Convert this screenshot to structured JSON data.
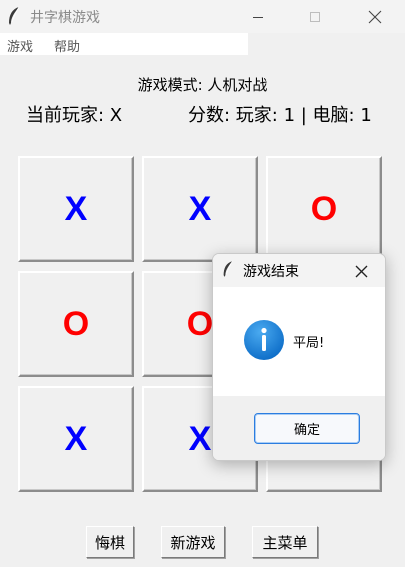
{
  "window": {
    "title": "井字棋游戏",
    "icon": "feather-icon",
    "controls": [
      "minimize-icon",
      "maximize-icon",
      "close-icon"
    ]
  },
  "menu": {
    "items": [
      {
        "label": "游戏"
      },
      {
        "label": "帮助"
      }
    ]
  },
  "status": {
    "mode": "游戏模式: 人机对战",
    "current_player": "当前玩家: X",
    "score": "分数: 玩家: 1 | 电脑: 1"
  },
  "board": {
    "cells": [
      {
        "mark": "X"
      },
      {
        "mark": "X"
      },
      {
        "mark": "O"
      },
      {
        "mark": "O"
      },
      {
        "mark": "O"
      },
      {
        "mark": ""
      },
      {
        "mark": "X"
      },
      {
        "mark": "X"
      },
      {
        "mark": ""
      }
    ],
    "colors": {
      "X": "#0000ff",
      "O": "#ff0000"
    }
  },
  "buttons": {
    "undo": "悔棋",
    "new_game": "新游戏",
    "main_menu": "主菜单"
  },
  "dialog": {
    "title": "游戏结束",
    "message": "平局!",
    "ok": "确定",
    "icon": "info-icon",
    "accent": "#1a7fd6"
  }
}
